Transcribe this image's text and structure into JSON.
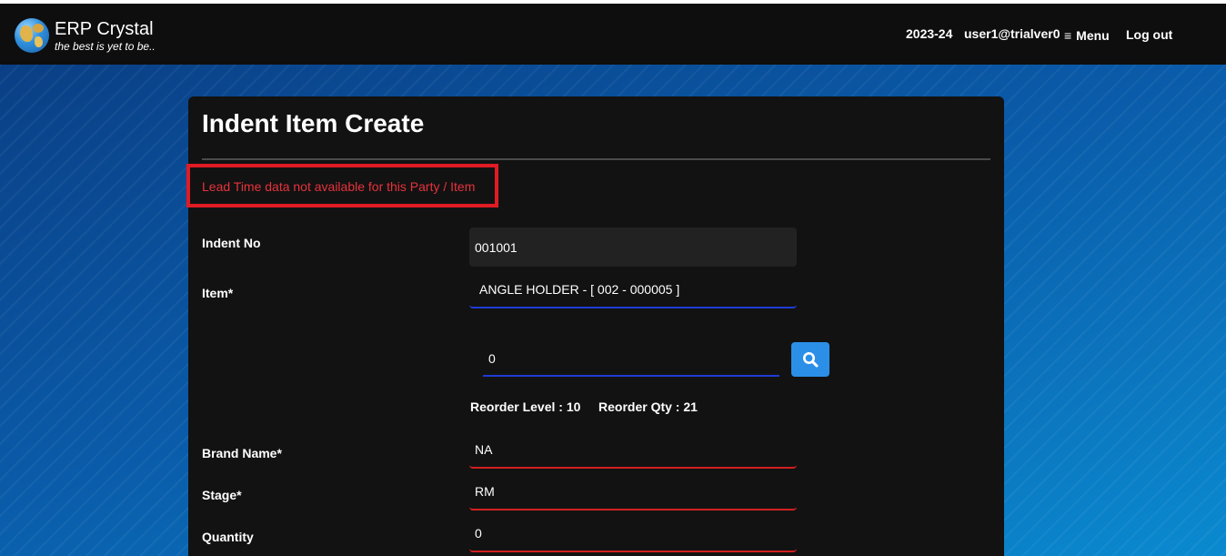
{
  "header": {
    "app_name": "ERP Crystal",
    "tagline": "the best is yet to be..",
    "year": "2023-24",
    "user": "user1@trialver0",
    "menu_label": "Menu",
    "logout_label": "Log out"
  },
  "page": {
    "title": "Indent Item Create",
    "alert": "Lead Time data not available for this Party / Item"
  },
  "form": {
    "indent_no_label": "Indent No",
    "indent_no_value": "001001",
    "item_label": "Item*",
    "item_value": "ANGLE HOLDER - [ 002 - 000005 ]",
    "search_value": "0",
    "reorder_level": "Reorder Level : 10",
    "reorder_qty": "Reorder Qty : 21",
    "brand_label": "Brand Name*",
    "brand_value": "NA",
    "stage_label": "Stage*",
    "stage_value": "RM",
    "quantity_label": "Quantity",
    "quantity_value": "0"
  },
  "colors": {
    "alert_red": "#e8323c",
    "focus_blue": "#1f3cd6",
    "error_red": "#d21f1f",
    "button_blue": "#2b8fe8"
  },
  "icons": [
    "globe-logo-icon",
    "hamburger-icon",
    "search-icon"
  ]
}
